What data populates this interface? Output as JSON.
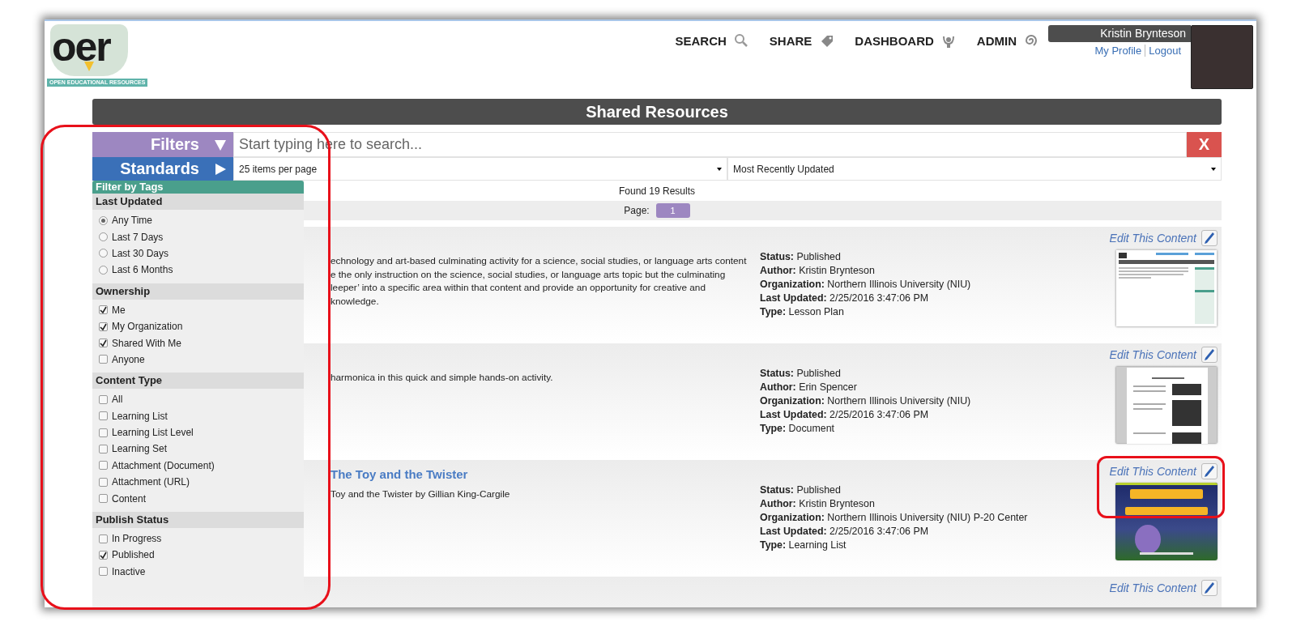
{
  "logo": {
    "wordmark": "oer",
    "tagline": "OPEN EDUCATIONAL RESOURCES"
  },
  "nav": [
    {
      "label": "SEARCH"
    },
    {
      "label": "SHARE"
    },
    {
      "label": "DASHBOARD"
    },
    {
      "label": "ADMIN"
    }
  ],
  "user": {
    "name": "Kristin Brynteson",
    "links": [
      "My Profile",
      "Logout"
    ]
  },
  "page_title": "Shared Resources",
  "toggles": [
    {
      "label": "Filters",
      "expanded": true,
      "color": "#9d87c1"
    },
    {
      "label": "Standards",
      "expanded": false,
      "color": "#3a70b8"
    }
  ],
  "search": {
    "placeholder": "Start typing here to search...",
    "clear_label": "X"
  },
  "page_size": "25 items per page",
  "sort": "Most Recently Updated",
  "results_count": "Found 19 Results",
  "pagination": {
    "label": "Page:",
    "pages": [
      {
        "label": "1",
        "selected": true
      }
    ]
  },
  "filter_panel": {
    "title": "Filter by Tags",
    "groups": [
      {
        "title": "Last Updated",
        "kind": "radio",
        "options": [
          {
            "label": "Any Time",
            "selected": true
          },
          {
            "label": "Last 7 Days",
            "selected": false
          },
          {
            "label": "Last 30 Days",
            "selected": false
          },
          {
            "label": "Last 6 Months",
            "selected": false
          }
        ]
      },
      {
        "title": "Ownership",
        "kind": "checkbox",
        "options": [
          {
            "label": "Me",
            "checked": true
          },
          {
            "label": "My Organization",
            "checked": true
          },
          {
            "label": "Shared With Me",
            "checked": true
          },
          {
            "label": "Anyone",
            "checked": false
          }
        ]
      },
      {
        "title": "Content Type",
        "kind": "checkbox",
        "options": [
          {
            "label": "All",
            "checked": false
          },
          {
            "label": "Learning List",
            "checked": false
          },
          {
            "label": "Learning List Level",
            "checked": false
          },
          {
            "label": "Learning Set",
            "checked": false
          },
          {
            "label": "Attachment (Document)",
            "checked": false
          },
          {
            "label": "Attachment (URL)",
            "checked": false
          },
          {
            "label": "Content",
            "checked": false
          }
        ]
      },
      {
        "title": "Publish Status",
        "kind": "checkbox",
        "options": [
          {
            "label": "In Progress",
            "checked": false
          },
          {
            "label": "Published",
            "checked": true
          },
          {
            "label": "Inactive",
            "checked": false
          }
        ]
      }
    ]
  },
  "results": [
    {
      "description_lines": [
        "echnology and art-based culminating activity for a science, social studies, or language arts content",
        "e the only instruction on the science, social studies, or language arts topic but the culminating",
        "leeper’ into a specific area within that content and provide an opportunity for creative and",
        "knowledge."
      ],
      "meta": [
        {
          "label": "Status:",
          "value": "Published"
        },
        {
          "label": "Author:",
          "value": "Kristin Brynteson"
        },
        {
          "label": "Organization:",
          "value": "Northern Illinois University (NIU)"
        },
        {
          "label": "Last Updated:",
          "value": "2/25/2016 3:47:06 PM"
        },
        {
          "label": "Type:",
          "value": "Lesson Plan"
        }
      ],
      "edit_label": "Edit This Content"
    },
    {
      "description_lines": [
        "harmonica in this quick and simple hands-on activity."
      ],
      "meta": [
        {
          "label": "Status:",
          "value": "Published"
        },
        {
          "label": "Author:",
          "value": "Erin Spencer"
        },
        {
          "label": "Organization:",
          "value": "Northern Illinois University (NIU)"
        },
        {
          "label": "Last Updated:",
          "value": "2/25/2016 3:47:06 PM"
        },
        {
          "label": "Type:",
          "value": "Document"
        }
      ],
      "edit_label": "Edit This Content"
    },
    {
      "title": "The Toy and the Twister",
      "description_lines": [
        "Toy and the Twister by Gillian King-Cargile"
      ],
      "meta": [
        {
          "label": "Status:",
          "value": "Published"
        },
        {
          "label": "Author:",
          "value": "Kristin Brynteson"
        },
        {
          "label": "Organization:",
          "value": "Northern Illinois University (NIU) P-20 Center"
        },
        {
          "label": "Last Updated:",
          "value": "2/25/2016 3:47:06 PM"
        },
        {
          "label": "Type:",
          "value": "Learning List"
        }
      ],
      "edit_label": "Edit This Content"
    },
    {
      "edit_label": "Edit This Content"
    }
  ]
}
